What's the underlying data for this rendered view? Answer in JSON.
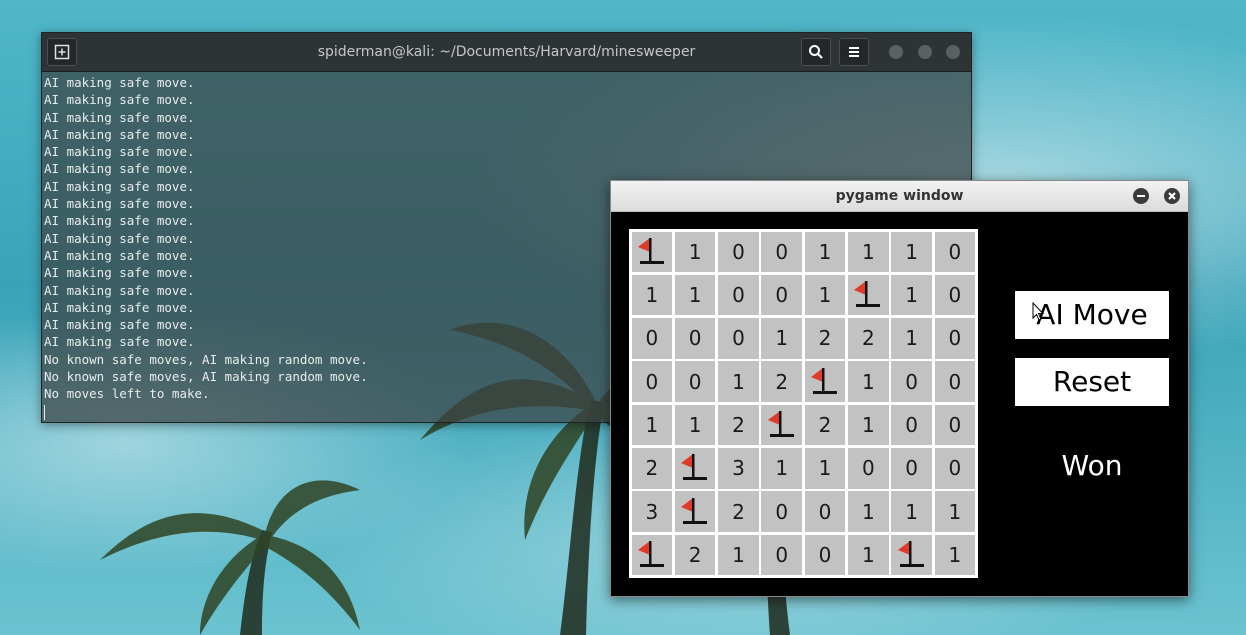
{
  "terminal": {
    "title": "spiderman@kali: ~/Documents/Harvard/minesweeper",
    "lines": [
      "AI making safe move.",
      "AI making safe move.",
      "AI making safe move.",
      "AI making safe move.",
      "AI making safe move.",
      "AI making safe move.",
      "AI making safe move.",
      "AI making safe move.",
      "AI making safe move.",
      "AI making safe move.",
      "AI making safe move.",
      "AI making safe move.",
      "AI making safe move.",
      "AI making safe move.",
      "AI making safe move.",
      "AI making safe move.",
      "No known safe moves, AI making random move.",
      "No known safe moves, AI making random move.",
      "No moves left to make."
    ]
  },
  "pygame": {
    "title": "pygame window",
    "ai_move_label": "AI Move",
    "reset_label": "Reset",
    "status": "Won",
    "board": [
      [
        "F",
        "1",
        "0",
        "0",
        "1",
        "1",
        "1",
        "0"
      ],
      [
        "1",
        "1",
        "0",
        "0",
        "1",
        "F",
        "1",
        "0"
      ],
      [
        "0",
        "0",
        "0",
        "1",
        "2",
        "2",
        "1",
        "0"
      ],
      [
        "0",
        "0",
        "1",
        "2",
        "F",
        "1",
        "0",
        "0"
      ],
      [
        "1",
        "1",
        "2",
        "F",
        "2",
        "1",
        "0",
        "0"
      ],
      [
        "2",
        "F",
        "3",
        "1",
        "1",
        "0",
        "0",
        "0"
      ],
      [
        "3",
        "F",
        "2",
        "0",
        "0",
        "1",
        "1",
        "1"
      ],
      [
        "F",
        "2",
        "1",
        "0",
        "0",
        "1",
        "F",
        "1"
      ]
    ]
  },
  "colors": {
    "flag_red": "#e03a2a",
    "cell_gray": "#c2c2c2"
  },
  "icons": {
    "new_tab": "new-tab-icon",
    "search": "search-icon",
    "menu": "hamburger-menu-icon",
    "flag": "flag-icon"
  }
}
